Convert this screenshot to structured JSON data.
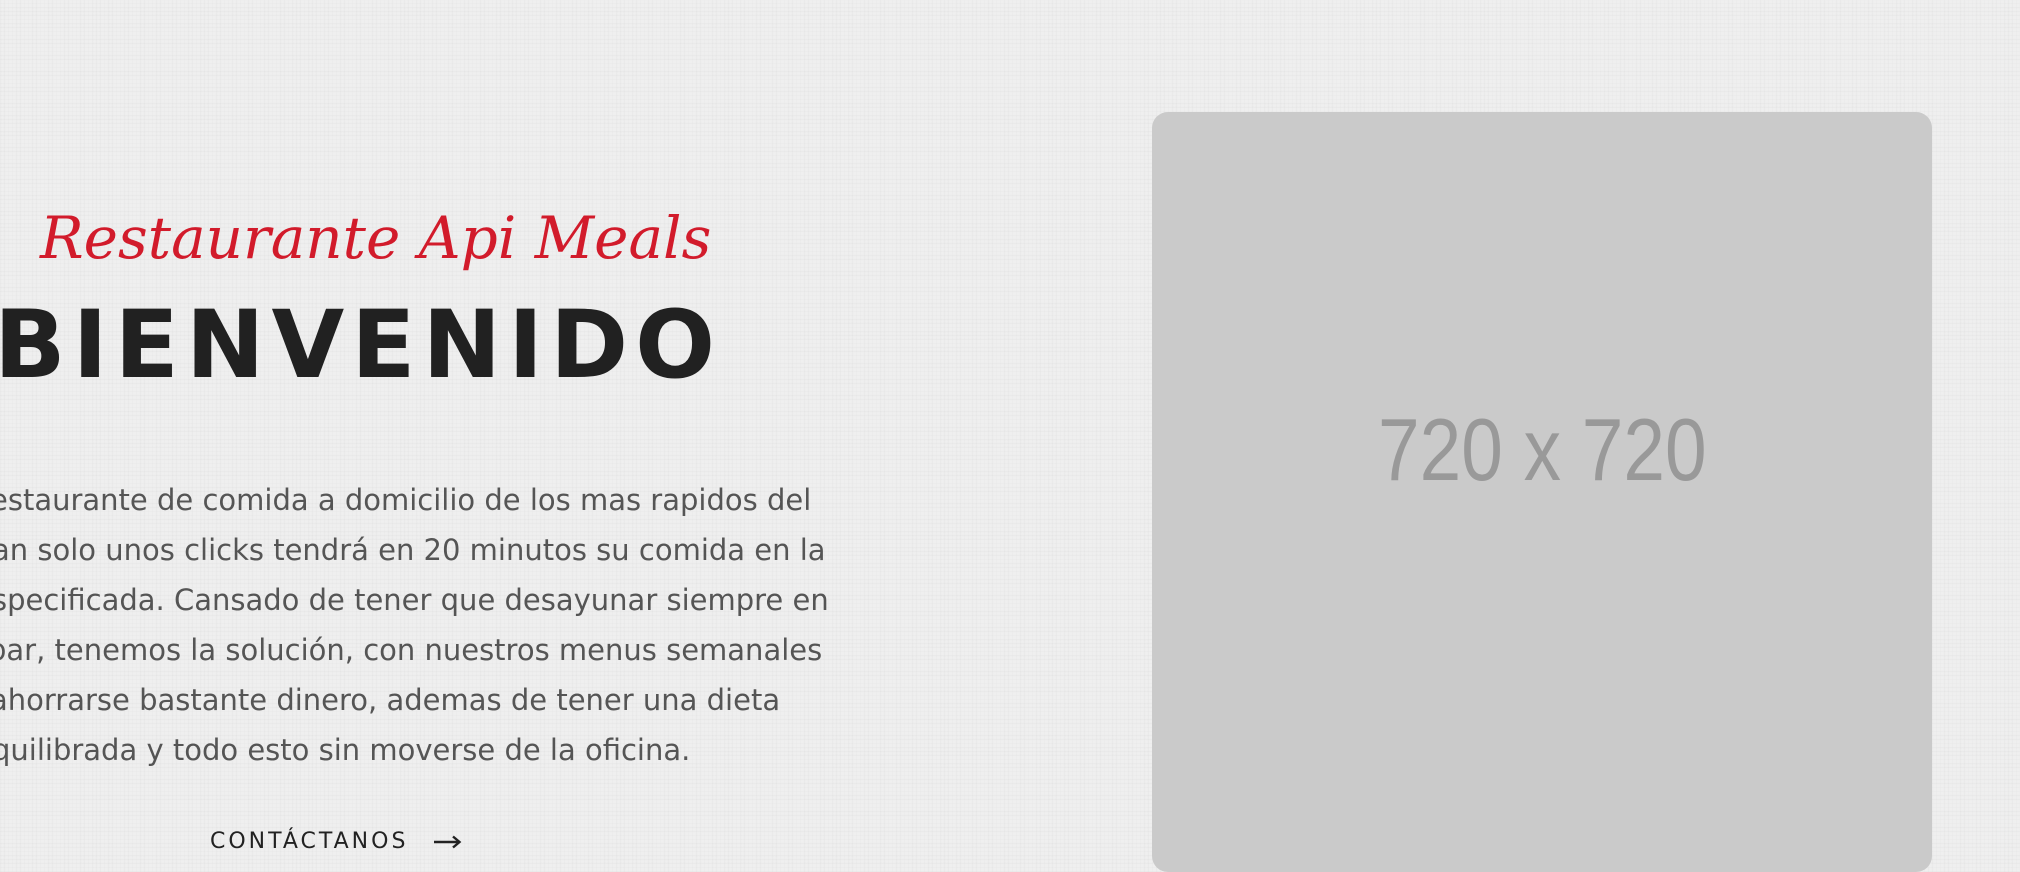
{
  "hero": {
    "tagline": "Restaurante Api Meals",
    "headline": "BIENVENIDO",
    "description_lines": [
      "estaurante de comida a domicilio de los mas rapidos del",
      "an solo unos clicks tendrá en 20 minutos su comida en la",
      "specificada. Cansado de tener que desayunar siempre en",
      "par, tenemos la solución, con nuestros menus semanales",
      "ahorrarse bastante dinero, ademas de tener una dieta",
      "quilibrada y todo esto sin moverse de la oficina."
    ],
    "cta_label": "CONTÁCTANOS",
    "cta_icon": "arrow-right-icon"
  },
  "image": {
    "placeholder_label": "720 x 720"
  },
  "colors": {
    "accent": "#d21b2b",
    "headline": "#212121",
    "body_text": "#555555",
    "background": "#efefef",
    "placeholder": "#cacaca",
    "placeholder_text": "#999999"
  }
}
